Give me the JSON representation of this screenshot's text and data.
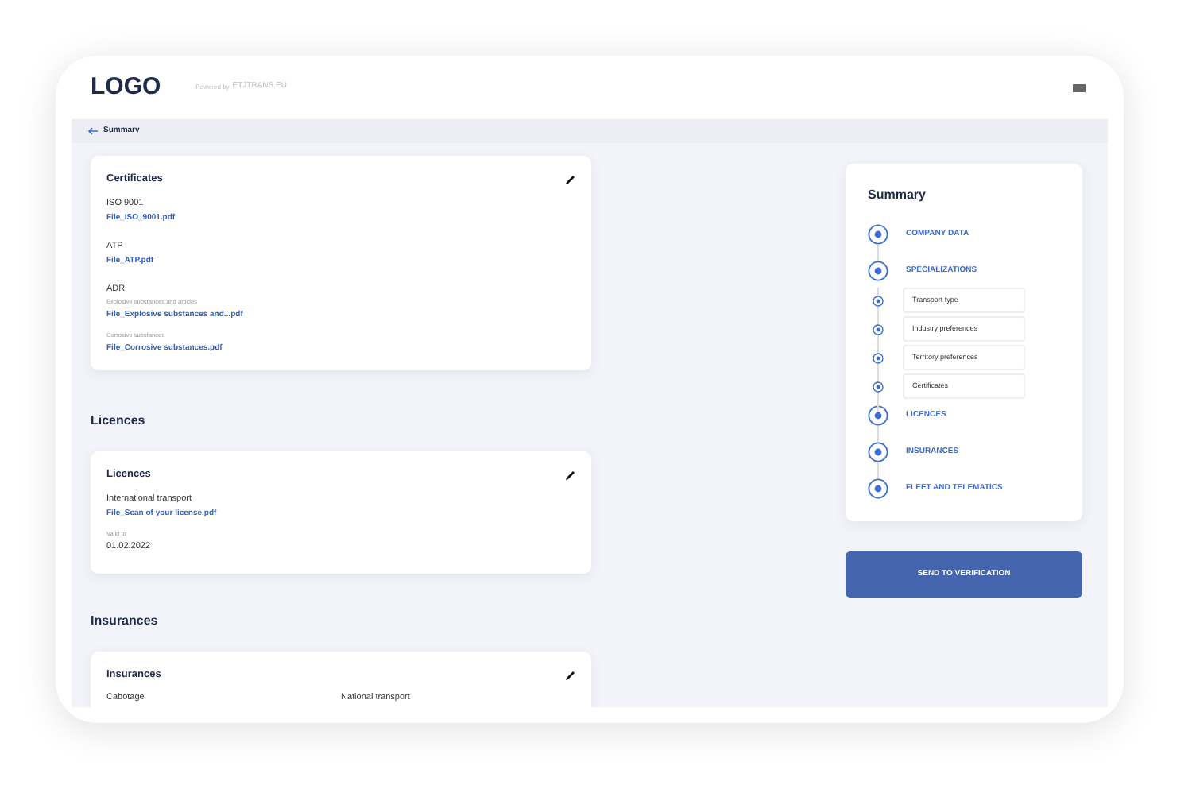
{
  "header": {
    "logo": "LOGO",
    "powered_by": "Powered by",
    "brand": "ETJTRANS.EU"
  },
  "back_link": {
    "label": "Summary"
  },
  "sections": [
    {
      "card": {
        "title": "Certificates",
        "items": [
          {
            "kind": "label",
            "text": "ISO 9001"
          },
          {
            "kind": "link",
            "text": "File_ISO_9001.pdf"
          },
          {
            "kind": "label",
            "text": "ATP"
          },
          {
            "kind": "link",
            "text": "File_ATP.pdf"
          },
          {
            "kind": "label",
            "text": "ADR"
          },
          {
            "kind": "sublabel",
            "text": "Explosive substances and articles"
          },
          {
            "kind": "link",
            "text": "File_Explosive substances and...pdf"
          },
          {
            "kind": "sublabel",
            "text": "Corrosive substances"
          },
          {
            "kind": "link",
            "text": "File_Corrosive substances.pdf"
          }
        ]
      }
    },
    {
      "heading": "Licences",
      "card": {
        "title": "Licences",
        "items": [
          {
            "kind": "label",
            "text": "International transport"
          },
          {
            "kind": "link",
            "text": "File_Scan of your license.pdf"
          },
          {
            "kind": "sublabel",
            "text": "Valid to"
          },
          {
            "kind": "value",
            "text": "01.02.2022"
          }
        ]
      }
    },
    {
      "heading": "Insurances",
      "card": {
        "title": "Insurances",
        "items": [
          {
            "kind": "pair",
            "text": "Cabotage",
            "text2": "National transport"
          }
        ]
      }
    }
  ],
  "summary": {
    "title": "Summary",
    "steps": [
      {
        "label": "COMPANY DATA"
      },
      {
        "label": "SPECIALIZATIONS",
        "children": [
          {
            "label": "Transport type"
          },
          {
            "label": "Industry preferences"
          },
          {
            "label": "Territory preferences"
          },
          {
            "label": "Certificates"
          }
        ]
      },
      {
        "label": "LICENCES"
      },
      {
        "label": "INSURANCES"
      },
      {
        "label": "FLEET AND TELEMATICS"
      }
    ]
  },
  "send_button": {
    "label": "SEND TO VERIFICATION"
  }
}
